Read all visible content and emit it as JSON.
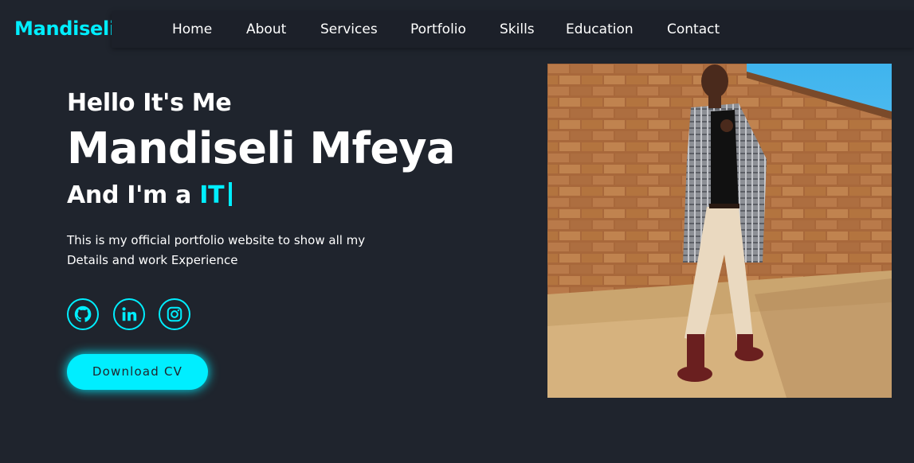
{
  "brand": {
    "logo_text": "Mandiseli",
    "accent_color": "#00eeff",
    "background_color": "#1f242d"
  },
  "nav": {
    "items": [
      {
        "label": "Home"
      },
      {
        "label": "About"
      },
      {
        "label": "Services"
      },
      {
        "label": "Portfolio"
      },
      {
        "label": "Skills"
      },
      {
        "label": "Education"
      },
      {
        "label": "Contact"
      }
    ]
  },
  "hero": {
    "greeting": "Hello It's Me",
    "name": "Mandiseli Mfeya",
    "role_prefix": "And I'm a",
    "role_value": "IT",
    "bio": "This is my official portfolio website to show all my Details and work Experience",
    "download_label": "Download CV"
  },
  "socials": [
    {
      "icon": "github-icon"
    },
    {
      "icon": "linkedin-icon"
    },
    {
      "icon": "instagram-icon"
    }
  ],
  "profile_photo": {
    "icon": "profile-photo"
  }
}
